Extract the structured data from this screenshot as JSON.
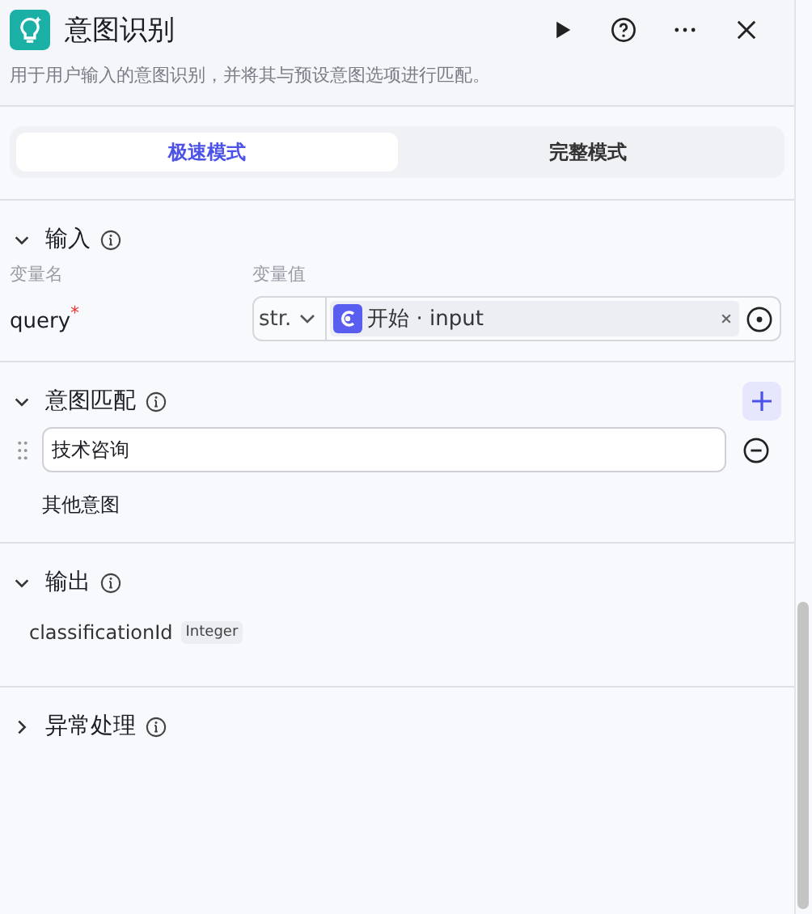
{
  "title": "意图识别",
  "description": "用于用户输入的意图识别，并将其与预设意图选项进行匹配。",
  "modes": [
    {
      "label": "极速模式",
      "selected": true
    },
    {
      "label": "完整模式",
      "selected": false
    }
  ],
  "sections": [
    {
      "kind": "input",
      "title": "输入",
      "expanded": true,
      "columns": [
        "变量名",
        "变量值"
      ],
      "rows": [
        {
          "name": "query",
          "required_mark": "*",
          "type": "str.",
          "value": "开始 · input"
        }
      ]
    },
    {
      "kind": "intents",
      "title": "意图匹配",
      "expanded": true,
      "items": [
        "技术咨询"
      ],
      "fallback": "其他意图"
    },
    {
      "kind": "output",
      "title": "输出",
      "expanded": true,
      "fields": [
        {
          "name": "classificationId",
          "type": "Integer"
        }
      ]
    },
    {
      "kind": "exception",
      "title": "异常处理",
      "expanded": false
    }
  ]
}
